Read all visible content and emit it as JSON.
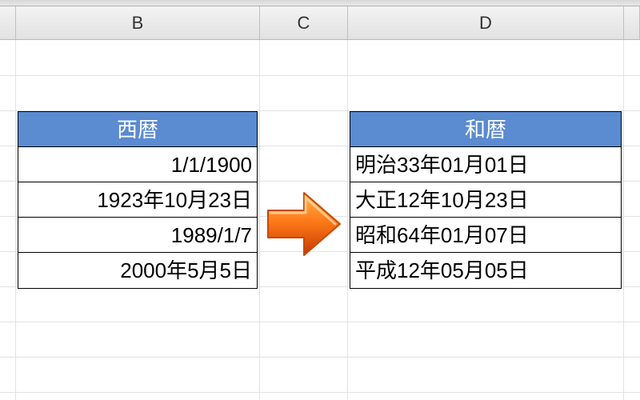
{
  "columns": {
    "B": "B",
    "C": "C",
    "D": "D"
  },
  "left_table": {
    "header": "西暦",
    "rows": [
      "1/1/1900",
      "1923年10月23日",
      "1989/1/7",
      "2000年5月5日"
    ]
  },
  "right_table": {
    "header": "和暦",
    "rows": [
      "明治33年01月01日",
      "大正12年10月23日",
      "昭和64年01月07日",
      "平成12年05月05日"
    ]
  },
  "chart_data": {
    "type": "table",
    "title": "西暦 → 和暦",
    "columns": [
      "西暦",
      "和暦"
    ],
    "rows": [
      [
        "1/1/1900",
        "明治33年01月01日"
      ],
      [
        "1923年10月23日",
        "大正12年10月23日"
      ],
      [
        "1989/1/7",
        "昭和64年01月07日"
      ],
      [
        "2000年5月5日",
        "平成12年05月05日"
      ]
    ]
  },
  "arrow": {
    "name": "right-arrow-icon",
    "fill_start": "#ff9a2e",
    "fill_end": "#d23a00"
  }
}
